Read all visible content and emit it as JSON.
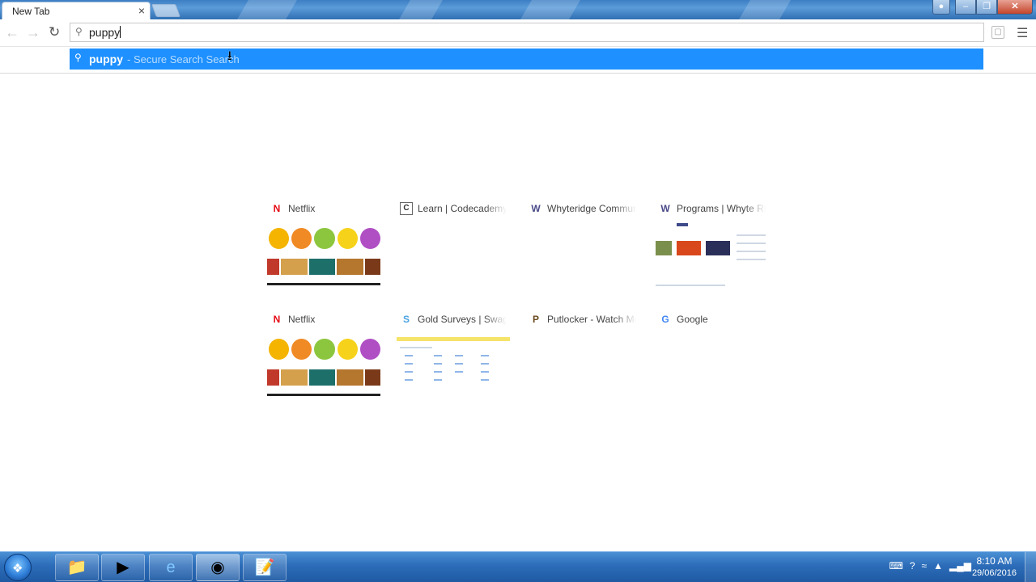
{
  "browser": {
    "tab_title": "New Tab",
    "tab_close_icon": "close-icon",
    "omnibox_text": "puppy",
    "suggestion": {
      "query": "puppy",
      "description": "- Secure Search Search"
    }
  },
  "most_visited": [
    {
      "title": "Netflix",
      "favicon": "N"
    },
    {
      "title": "Learn | Codecademy",
      "favicon": "C"
    },
    {
      "title": "Whyteridge Community",
      "favicon": "W"
    },
    {
      "title": "Programs | Whyte Ridge",
      "favicon": "W"
    },
    {
      "title": "Netflix",
      "favicon": "N"
    },
    {
      "title": "Gold Surveys | Swagbucks",
      "favicon": "S"
    },
    {
      "title": "Putlocker - Watch Movies",
      "favicon": "P"
    },
    {
      "title": "Google",
      "favicon": "G"
    }
  ],
  "taskbar": {
    "clock_time": "8:10 AM",
    "clock_date": "29/06/2016"
  },
  "colors": {
    "suggestion_bg": "#1e90ff",
    "netflix_red": "#e50914",
    "taskbar": "#2c6cb8"
  }
}
